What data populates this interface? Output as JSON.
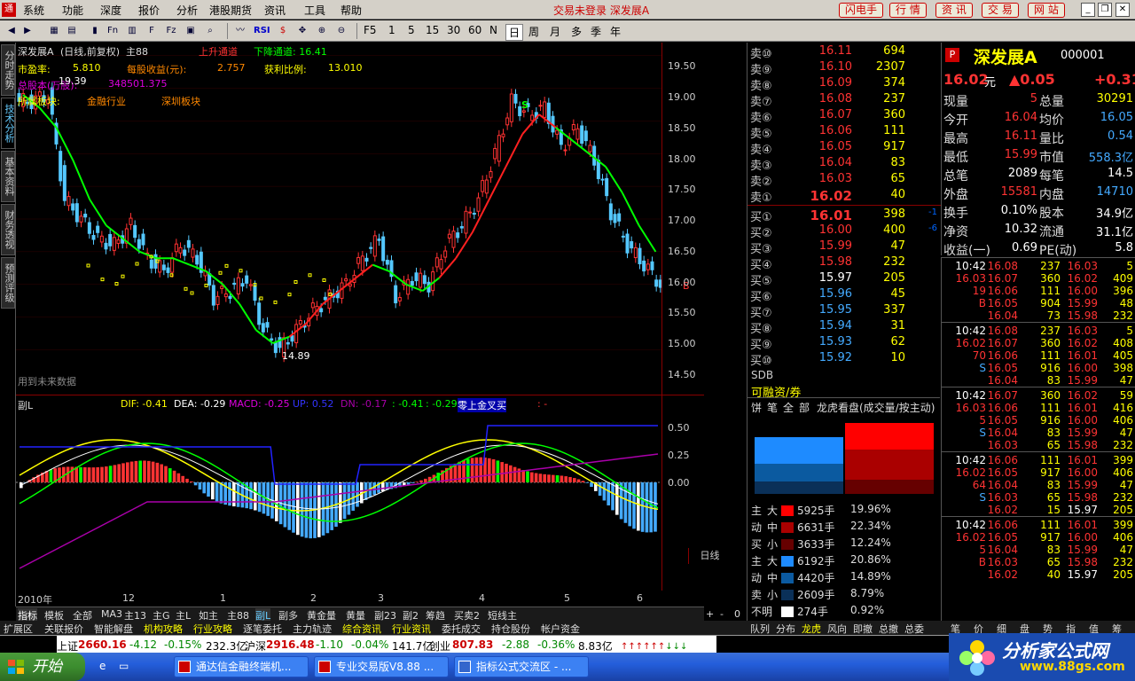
{
  "colors": {
    "up": "#ff3232",
    "down": "#54c8ff",
    "ma_green": "#00ff00",
    "ma_red": "#ff2020",
    "yellow": "#ffff00",
    "bg": "#000000"
  },
  "menu": {
    "items": [
      "系统",
      "功能",
      "深度",
      "报价",
      "分析",
      "港股期货",
      "资讯",
      "工具",
      "帮助"
    ],
    "title": "交易未登录  深发展A",
    "quick_buttons": [
      "闪电手",
      "行 情",
      "资 讯",
      "交 易",
      "网 站"
    ]
  },
  "toolbar": {
    "periods": [
      "F5",
      "1",
      "5",
      "15",
      "30",
      "60",
      "N",
      "日",
      "周",
      "月",
      "多",
      "季",
      "年"
    ],
    "active_period": "日"
  },
  "left_tabs": [
    "分时走势",
    "技术分析",
    "基本资料",
    "财务透视",
    "预测评级"
  ],
  "chart": {
    "header": {
      "name": "深发展A",
      "mode": "(日线,前复权)",
      "main": "主88",
      "up_channel": "上升通道",
      "down_channel": "下降通道: 16.41",
      "pe_label": "市盈率:",
      "pe_value": "5.810",
      "eps_label": "每股收益(元):",
      "eps_value": "2.757",
      "profit_label": "获利比例:",
      "profit_value": "13.010",
      "shares_label": "总股本(万股):",
      "shares_value": "348501.375",
      "sector_label": "所属板块:",
      "sector1": "金融行业",
      "sector2": "深圳板块",
      "hi_mark": "19.39",
      "low_mark": "14.89",
      "footnote": "用到未来数据",
      "s_mark": "S",
      "b_mark": "B"
    },
    "yaxis": [
      "19.50",
      "19.00",
      "18.50",
      "18.00",
      "17.50",
      "17.00",
      "16.50",
      "16.00",
      "15.50",
      "15.00",
      "14.50"
    ],
    "macd": {
      "title": "副L",
      "dif": "DIF: -0.41",
      "dea": "DEA: -0.29",
      "macd": "MACD: -0.25",
      "up": "UP: 0.52",
      "dn": "DN: -0.17",
      "v1": ": -0.41",
      "v2": ": -0.29",
      "extra": "零上金叉买",
      "dots": ": -",
      "yaxis": [
        "0.50",
        "0.25",
        "0.00"
      ]
    },
    "xaxis": [
      "2010年",
      "12",
      "1",
      "2",
      "3",
      "4",
      "5",
      "6"
    ],
    "xaxis_right": "日线",
    "chart_data": {
      "type": "line",
      "title": "深发展A",
      "ylim": [
        14.3,
        19.7
      ],
      "ma": [
        18.9,
        18.7,
        18.4,
        17.9,
        17.3,
        16.9,
        16.7,
        16.5,
        16.4,
        16.4,
        16.3,
        16.2,
        16.0,
        15.7,
        15.3,
        15.1,
        15.2,
        15.4,
        15.7,
        15.9,
        16.1,
        16.3,
        16.2,
        16.0,
        15.9,
        16.1,
        16.4,
        16.8,
        17.3,
        17.8,
        18.3,
        18.6,
        18.4,
        18.2,
        18.0,
        17.8,
        17.4,
        16.9,
        16.5
      ],
      "ma_colors": [
        "g",
        "g",
        "g",
        "g",
        "g",
        "g",
        "g",
        "g",
        "g",
        "g",
        "g",
        "g",
        "g",
        "g",
        "g",
        "g",
        "r",
        "r",
        "r",
        "r",
        "r",
        "g",
        "g",
        "g",
        "g",
        "r",
        "r",
        "r",
        "r",
        "r",
        "r",
        "r",
        "g",
        "g",
        "g",
        "g",
        "g",
        "g",
        "g"
      ],
      "candles_close": [
        18.8,
        18.9,
        17.3,
        17.0,
        16.7,
        16.6,
        16.9,
        16.4,
        16.2,
        16.6,
        16.4,
        15.8,
        15.9,
        16.1,
        15.3,
        15.0,
        15.3,
        15.6,
        15.8,
        16.0,
        16.4,
        16.7,
        15.8,
        16.1,
        16.0,
        16.6,
        16.9,
        17.3,
        18.0,
        18.8,
        18.6,
        18.7,
        18.1,
        18.4,
        17.9,
        17.1,
        16.6,
        16.3,
        16.0
      ]
    }
  },
  "indicator_tabs": [
    "指标",
    "模板",
    "全部",
    "MA3",
    "主13",
    "主G",
    "主L",
    "如主",
    "主88",
    "副L",
    "副多",
    "黄金量",
    "黄量",
    "副23",
    "副2",
    "筹趋",
    "买卖2",
    "短线主"
  ],
  "indicator_active": "副L",
  "bottom_tabs": [
    "扩展区",
    "关联报价",
    "智能解盘",
    "机构攻略",
    "行业攻略",
    "逐笔委托",
    "主力轨迹",
    "综合资讯",
    "行业资讯",
    "委托成交",
    "持仓股份",
    "帐户资金"
  ],
  "bottom_right": {
    "plus": "+",
    "minus": "-",
    "zero": "0"
  },
  "orderbook": {
    "sells": [
      {
        "label": "卖⑩",
        "price": "16.11",
        "vol": "694"
      },
      {
        "label": "卖⑨",
        "price": "16.10",
        "vol": "2307"
      },
      {
        "label": "卖⑧",
        "price": "16.09",
        "vol": "374"
      },
      {
        "label": "卖⑦",
        "price": "16.08",
        "vol": "237"
      },
      {
        "label": "卖⑥",
        "price": "16.07",
        "vol": "360"
      },
      {
        "label": "卖⑤",
        "price": "16.06",
        "vol": "111"
      },
      {
        "label": "卖④",
        "price": "16.05",
        "vol": "917"
      },
      {
        "label": "卖③",
        "price": "16.04",
        "vol": "83"
      },
      {
        "label": "卖②",
        "price": "16.03",
        "vol": "65"
      },
      {
        "label": "卖①",
        "price": "16.02",
        "vol": "40"
      }
    ],
    "buys": [
      {
        "label": "买①",
        "price": "16.01",
        "vol": "398",
        "chg": "-1"
      },
      {
        "label": "买②",
        "price": "16.00",
        "vol": "400",
        "chg": "-6"
      },
      {
        "label": "买③",
        "price": "15.99",
        "vol": "47",
        "chg": ""
      },
      {
        "label": "买④",
        "price": "15.98",
        "vol": "232",
        "chg": ""
      },
      {
        "label": "买⑤",
        "price": "15.97",
        "vol": "205",
        "chg": ""
      },
      {
        "label": "买⑥",
        "price": "15.96",
        "vol": "45",
        "chg": ""
      },
      {
        "label": "买⑦",
        "price": "15.95",
        "vol": "337",
        "chg": ""
      },
      {
        "label": "买⑧",
        "price": "15.94",
        "vol": "31",
        "chg": ""
      },
      {
        "label": "买⑨",
        "price": "15.93",
        "vol": "62",
        "chg": ""
      },
      {
        "label": "买⑩",
        "price": "15.92",
        "vol": "10",
        "chg": ""
      }
    ],
    "sdb": "SDB",
    "margin": "可融资/券"
  },
  "stock": {
    "badge": "P",
    "name": "深发展A",
    "code": "000001",
    "price": "16.02",
    "unit": "元",
    "change": "▲0.05",
    "change_pct": "+0.31",
    "rows": [
      [
        [
          "现量",
          "5"
        ],
        [
          "总量",
          "30291"
        ]
      ],
      [
        [
          "今开",
          "16.04"
        ],
        [
          "均价",
          "16.05"
        ]
      ],
      [
        [
          "最高",
          "16.11"
        ],
        [
          "量比",
          "0.54"
        ]
      ],
      [
        [
          "最低",
          "15.99"
        ],
        [
          "市值",
          "558.3亿"
        ]
      ],
      [
        [
          "总笔",
          "2089"
        ],
        [
          "每笔",
          "14.5"
        ]
      ],
      [
        [
          "外盘",
          "15581"
        ],
        [
          "内盘",
          "14710"
        ]
      ],
      [
        [
          "换手",
          "0.10%"
        ],
        [
          "股本",
          "34.9亿"
        ]
      ],
      [
        [
          "净资",
          "10.32"
        ],
        [
          "流通",
          "31.1亿"
        ]
      ],
      [
        [
          "收益(一)",
          "0.69"
        ],
        [
          "PE(动)",
          "5.8"
        ]
      ]
    ]
  },
  "ticks": [
    [
      [
        "10:42",
        "16.08",
        "237",
        "16.03",
        "5"
      ],
      [
        "16.03",
        "16.07",
        "360",
        "16.02",
        "409"
      ],
      [
        "19",
        "16.06",
        "111",
        "16.00",
        "396"
      ],
      [
        "B",
        "16.05",
        "904",
        "15.99",
        "48"
      ],
      [
        "",
        "16.04",
        "73",
        "15.98",
        "232"
      ]
    ],
    [
      [
        "10:42",
        "16.08",
        "237",
        "16.03",
        "5"
      ],
      [
        "16.02",
        "16.07",
        "360",
        "16.02",
        "408"
      ],
      [
        "70",
        "16.06",
        "111",
        "16.01",
        "405"
      ],
      [
        "S",
        "16.05",
        "916",
        "16.00",
        "398"
      ],
      [
        "",
        "16.04",
        "83",
        "15.99",
        "47"
      ]
    ],
    [
      [
        "10:42",
        "16.07",
        "360",
        "16.02",
        "59"
      ],
      [
        "16.03",
        "16.06",
        "111",
        "16.01",
        "416"
      ],
      [
        "5",
        "16.05",
        "916",
        "16.00",
        "406"
      ],
      [
        "S",
        "16.04",
        "83",
        "15.99",
        "47"
      ],
      [
        "",
        "16.03",
        "65",
        "15.98",
        "232"
      ]
    ],
    [
      [
        "10:42",
        "16.06",
        "111",
        "16.01",
        "399"
      ],
      [
        "16.02",
        "16.05",
        "917",
        "16.00",
        "406"
      ],
      [
        "64",
        "16.04",
        "83",
        "15.99",
        "47"
      ],
      [
        "S",
        "16.03",
        "65",
        "15.98",
        "232"
      ],
      [
        "",
        "16.02",
        "15",
        "15.97",
        "205"
      ]
    ],
    [
      [
        "10:42",
        "16.06",
        "111",
        "16.01",
        "399"
      ],
      [
        "16.02",
        "16.05",
        "917",
        "16.00",
        "406"
      ],
      [
        "5",
        "16.04",
        "83",
        "15.99",
        "47"
      ],
      [
        "B",
        "16.03",
        "65",
        "15.98",
        "232"
      ],
      [
        "",
        "16.02",
        "40",
        "15.97",
        "205"
      ]
    ]
  ],
  "moneyflow": {
    "tabs": [
      "饼",
      "笔",
      "全",
      "部",
      "龙虎看盘(成交量/按主动)"
    ],
    "rows": [
      {
        "g": "主",
        "s": "大",
        "color": "#ff0000",
        "vol": "5925手",
        "pct": "19.96%"
      },
      {
        "g": "动",
        "s": "中",
        "color": "#aa0000",
        "vol": "6631手",
        "pct": "22.34%"
      },
      {
        "g": "买",
        "s": "小",
        "color": "#660000",
        "vol": "3633手",
        "pct": "12.24%"
      },
      {
        "g": "主",
        "s": "大",
        "color": "#1e8bff",
        "vol": "6192手",
        "pct": "20.86%"
      },
      {
        "g": "动",
        "s": "中",
        "color": "#0b5aa0",
        "vol": "4420手",
        "pct": "14.89%"
      },
      {
        "g": "卖",
        "s": "小",
        "color": "#0a3058",
        "vol": "2609手",
        "pct": "8.79%"
      },
      {
        "g": "不明",
        "s": "",
        "color": "#ffffff",
        "vol": "274手",
        "pct": "0.92%"
      }
    ]
  },
  "right_bottom_tabs": [
    "队列",
    "分布",
    "龙虎",
    "风向",
    "即撤",
    "总撤",
    "总委",
    "笔",
    "价",
    "细",
    "盘",
    "势",
    "指",
    "值",
    "筹"
  ],
  "right_bottom_active": "龙虎",
  "status": {
    "sh_label": "上证",
    "sh": "2660.16",
    "sh_chg": "-4.12",
    "sh_pct": "-0.15%",
    "sh_amt": "232.3亿",
    "sz_label": "沪深",
    "sz": "2916.48",
    "sz_chg": "-1.10",
    "sz_pct": "-0.04%",
    "sz_amt": "141.7亿",
    "cy_label": "创业",
    "cy": "807.83",
    "cy_chg": "-2.88",
    "cy_pct": "-0.36%",
    "cy_amt": "8.83亿"
  },
  "taskbar": {
    "start": "开始",
    "tasks": [
      "通达信金融终端机...",
      "专业交易版V8.88 ...",
      "指标公式交流区 - ..."
    ]
  },
  "watermark": {
    "title": "分析家公式网",
    "url": "www.88gs.com"
  }
}
